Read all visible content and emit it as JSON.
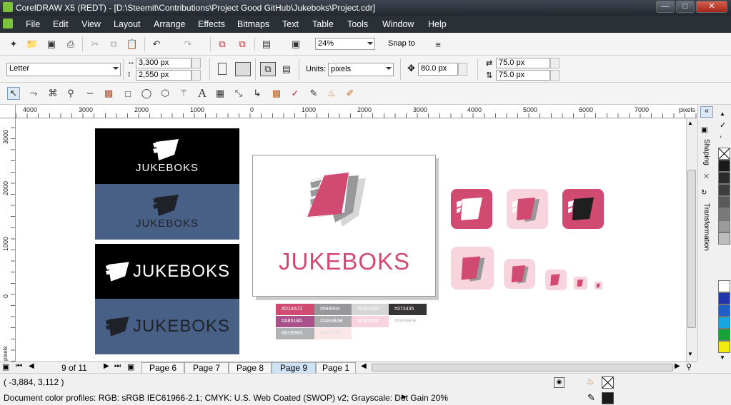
{
  "window": {
    "title": "CorelDRAW X5 (REDT) - [D:\\Steemit\\Contributions\\Project Good GitHub\\Jukeboks\\Project.cdr]"
  },
  "menu": {
    "items": [
      "File",
      "Edit",
      "View",
      "Layout",
      "Arrange",
      "Effects",
      "Bitmaps",
      "Text",
      "Table",
      "Tools",
      "Window",
      "Help"
    ]
  },
  "standard_toolbar": {
    "zoom": "24%",
    "snap_to": "Snap to"
  },
  "property_bar": {
    "page_size": "Letter",
    "width": "3,300 px",
    "height": "2,550 px",
    "units_label": "Units:",
    "units": "pixels",
    "nudge": "80.0 px",
    "dup_x": "75.0 px",
    "dup_y": "75.0 px"
  },
  "ruler": {
    "h_labels": [
      "4000",
      "3000",
      "2000",
      "1000",
      "0",
      "1000",
      "2000",
      "3000",
      "4000",
      "5000",
      "6000",
      "7000"
    ],
    "h_unit": "pixels",
    "v_labels": [
      "3000",
      "2000",
      "1000",
      "0"
    ],
    "v_unit": "pixels"
  },
  "canvas": {
    "logo_text": "JUKEBOKS",
    "brand_color": "#D14A72",
    "swatches": [
      {
        "hex": "#D14A72",
        "label": "#D14A72"
      },
      {
        "hex": "#98989A",
        "label": "#98989A"
      },
      {
        "hex": "#D6D6D6",
        "label": "#D6D6D6"
      },
      {
        "hex": "#373435",
        "label": "#373435"
      },
      {
        "hex": "#A8518A",
        "label": "#A8518A"
      },
      {
        "hex": "#ABABAE",
        "label": "#ABABAE"
      },
      {
        "hex": "#F8D5DE",
        "label": "#F8D5DE"
      },
      {
        "hex": "#FEFEFE",
        "label": "#FEFEFE"
      },
      {
        "hex": "#B2B3B5",
        "label": "#B2B3B5"
      },
      {
        "hex": "#FBE7E8",
        "label": "#FBE7E8"
      }
    ]
  },
  "pages": {
    "counter": "9 of 11",
    "tabs": [
      "Page 6",
      "Page 7",
      "Page 8",
      "Page 9",
      "Page 1"
    ],
    "active": "Page 9"
  },
  "dockers": {
    "shaping": "Shaping",
    "transformation": "Transformation"
  },
  "status": {
    "coords": "( -3,884, 3,112 )",
    "color_profiles": "Document color profiles: RGB: sRGB IEC61966-2.1; CMYK: U.S. Web Coated (SWOP) v2; Grayscale: Dot Gain 20%"
  },
  "palette_colors": [
    "#ffffff",
    "#1a1a1a",
    "#2b2b2b",
    "#3d3d3d",
    "#5a5a5a",
    "#7a7a7a",
    "#9a9a9a",
    "#bcbcbc",
    "#ffffff",
    "#2036a8",
    "#1f5fc6",
    "#19a6df",
    "#1aa23a",
    "#f0ea10"
  ]
}
